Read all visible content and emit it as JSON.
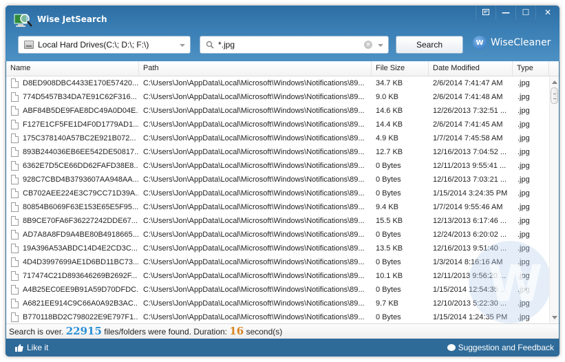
{
  "app": {
    "title": "Wise JetSearch"
  },
  "window_controls": {
    "menu": "menu-icon",
    "minimize": "—",
    "maximize": "☐",
    "close": "✕"
  },
  "toolbar": {
    "drive_select": {
      "value": "Local Hard Drives(C:\\; D:\\; F:\\)"
    },
    "search": {
      "value": "*.jpg",
      "placeholder": ""
    },
    "search_button": "Search",
    "brand": {
      "icon_letter": "W",
      "name": "WiseCleaner"
    }
  },
  "table": {
    "columns": [
      "Name",
      "Path",
      "File Size",
      "Date Modified",
      "Type"
    ],
    "rows": [
      {
        "name": "D8ED908DBC4433E170E57420...",
        "path": "C:\\Users\\Jon\\AppData\\Local\\Microsoft\\Windows\\Notifications\\89...",
        "size": "34.7 KB",
        "date": "2/6/2014 7:41:47 AM",
        "type": ".jpg"
      },
      {
        "name": "774D5457B34DA7E91C62F316...",
        "path": "C:\\Users\\Jon\\AppData\\Local\\Microsoft\\Windows\\Notifications\\89...",
        "size": "9.0 KB",
        "date": "2/6/2014 7:41:48 AM",
        "type": ".jpg"
      },
      {
        "name": "ABF84B5DE9FAE8DC49A0D04E...",
        "path": "C:\\Users\\Jon\\AppData\\Local\\Microsoft\\Windows\\Notifications\\89...",
        "size": "14.6 KB",
        "date": "12/26/2013 7:32:51 ...",
        "type": ".jpg"
      },
      {
        "name": "F127E1CF5FE1D4F0D1779AD1...",
        "path": "C:\\Users\\Jon\\AppData\\Local\\Microsoft\\Windows\\Notifications\\89...",
        "size": "14.4 KB",
        "date": "2/6/2014 7:41:45 AM",
        "type": ".jpg"
      },
      {
        "name": "175C378140A57BC2E921B072...",
        "path": "C:\\Users\\Jon\\AppData\\Local\\Microsoft\\Windows\\Notifications\\89...",
        "size": "4.9 KB",
        "date": "1/7/2014 7:45:58 AM",
        "type": ".jpg"
      },
      {
        "name": "893B244036EB6EE542DE50817...",
        "path": "C:\\Users\\Jon\\AppData\\Local\\Microsoft\\Windows\\Notifications\\89...",
        "size": "12.7 KB",
        "date": "12/16/2013 7:04:52 ...",
        "type": ".jpg"
      },
      {
        "name": "6362E7D5CE66DD62FAFD38E8...",
        "path": "C:\\Users\\Jon\\AppData\\Local\\Microsoft\\Windows\\Notifications\\89...",
        "size": "0 Bytes",
        "date": "12/11/2013 9:55:41 ...",
        "type": ".jpg"
      },
      {
        "name": "928C7CBD4B3793607AA948AA...",
        "path": "C:\\Users\\Jon\\AppData\\Local\\Microsoft\\Windows\\Notifications\\89...",
        "size": "0 Bytes",
        "date": "12/16/2013 7:03:21 ...",
        "type": ".jpg"
      },
      {
        "name": "CB702AEE224E3C79CC71D39A...",
        "path": "C:\\Users\\Jon\\AppData\\Local\\Microsoft\\Windows\\Notifications\\89...",
        "size": "0 Bytes",
        "date": "1/15/2014 3:24:35 PM",
        "type": ".jpg"
      },
      {
        "name": "80854B6069F63E153E65E5F95...",
        "path": "C:\\Users\\Jon\\AppData\\Local\\Microsoft\\Windows\\Notifications\\89...",
        "size": "9.4 KB",
        "date": "1/7/2014 9:55:46 AM",
        "type": ".jpg"
      },
      {
        "name": "8B9CE70FA6F36227242DDE67...",
        "path": "C:\\Users\\Jon\\AppData\\Local\\Microsoft\\Windows\\Notifications\\89...",
        "size": "15.5 KB",
        "date": "12/13/2013 6:17:46 ...",
        "type": ".jpg"
      },
      {
        "name": "AD7A8A8FD9A4BE80B4918665...",
        "path": "C:\\Users\\Jon\\AppData\\Local\\Microsoft\\Windows\\Notifications\\89...",
        "size": "0 Bytes",
        "date": "12/24/2013 6:20:02 ...",
        "type": ".jpg"
      },
      {
        "name": "19A396A53ABDC14D4E2CD3C...",
        "path": "C:\\Users\\Jon\\AppData\\Local\\Microsoft\\Windows\\Notifications\\89...",
        "size": "13.5 KB",
        "date": "12/16/2013 9:51:40 ...",
        "type": ".jpg"
      },
      {
        "name": "4D4D3997699AE1D6BD11BC73...",
        "path": "C:\\Users\\Jon\\AppData\\Local\\Microsoft\\Windows\\Notifications\\89...",
        "size": "0 Bytes",
        "date": "1/3/2014 8:16:16 AM",
        "type": ".jpg"
      },
      {
        "name": "717474C21D893646269B2692F...",
        "path": "C:\\Users\\Jon\\AppData\\Local\\Microsoft\\Windows\\Notifications\\89...",
        "size": "10.1 KB",
        "date": "12/11/2013 9:56:20 ...",
        "type": ".jpg"
      },
      {
        "name": "A4B25EC0EE9B91A59D70DFDC...",
        "path": "C:\\Users\\Jon\\AppData\\Local\\Microsoft\\Windows\\Notifications\\89...",
        "size": "0 Bytes",
        "date": "1/15/2014 12:54:35 ...",
        "type": ".jpg"
      },
      {
        "name": "A6821EE914C9C66A0A92B3AC...",
        "path": "C:\\Users\\Jon\\AppData\\Local\\Microsoft\\Windows\\Notifications\\89...",
        "size": "9.7 KB",
        "date": "12/10/2013 5:22:30 ...",
        "type": ".jpg"
      },
      {
        "name": "B770118BD2C798022E9E797F1...",
        "path": "C:\\Users\\Jon\\AppData\\Local\\Microsoft\\Windows\\Notifications\\89...",
        "size": "0 Bytes",
        "date": "1/15/2014 1:24:35 PM",
        "type": ".jpg"
      }
    ]
  },
  "status": {
    "prefix": "Search is over.",
    "count": "22915",
    "middle": "files/folders were found. Duration:",
    "duration": "16",
    "suffix": "second(s)"
  },
  "footer": {
    "like": "Like it",
    "feedback": "Suggestion and Feedback"
  },
  "colors": {
    "accent": "#2f6b99",
    "count": "#2a8fd6",
    "duration": "#d78421"
  }
}
